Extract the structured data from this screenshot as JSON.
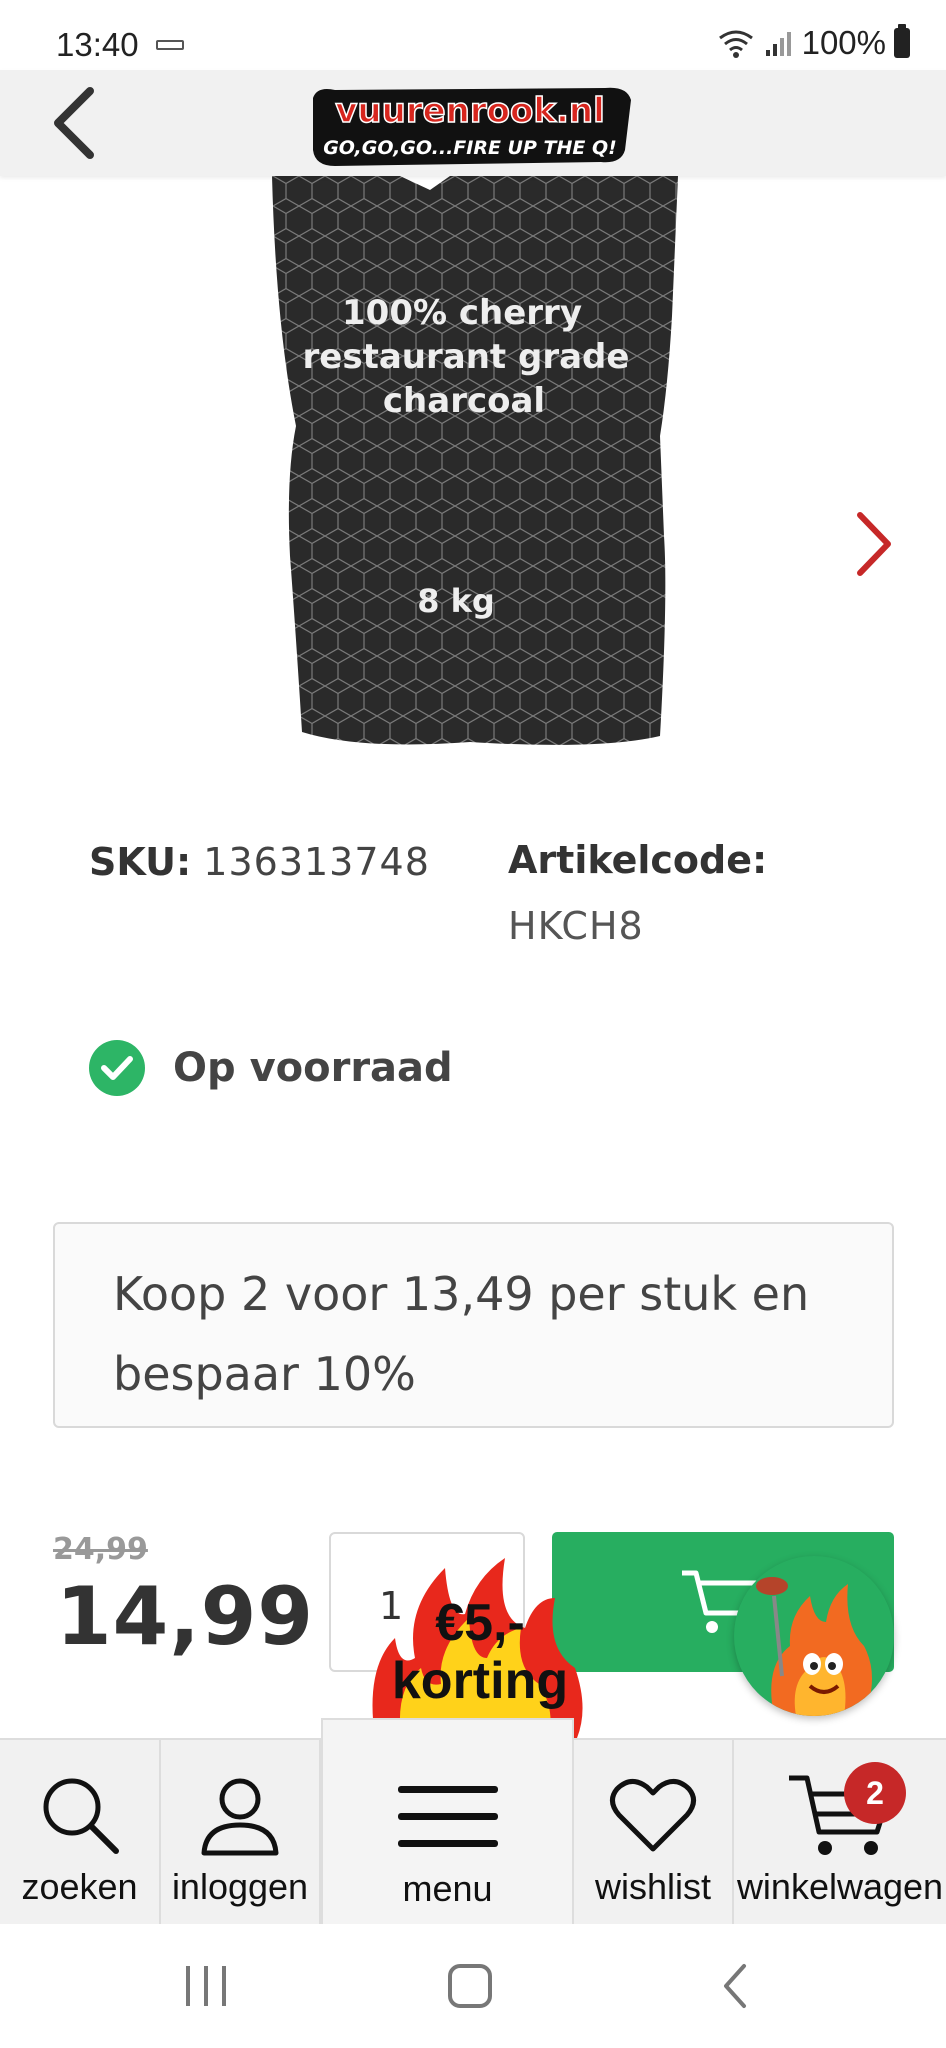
{
  "status_bar": {
    "time": "13:40",
    "battery": "100%"
  },
  "header": {
    "logo_text": "vuurenrook.nl",
    "logo_tagline": "GO,GO,GO...FIRE UP THE Q!"
  },
  "product": {
    "bag_line1": "100% cherry",
    "bag_line2": "restaurant grade",
    "bag_line3": "charcoal",
    "bag_weight": "8 kg",
    "sku_label": "SKU:",
    "sku_value": "136313748",
    "artikel_label": "Artikelcode:",
    "artikel_value": "HKCH8",
    "stock_status": "Op voorraad"
  },
  "offer": {
    "line1": "Koop 2 voor 13,49 per stuk en",
    "line2": "bespaar 10%"
  },
  "price": {
    "old": "24,99",
    "new": "14,99",
    "quantity": "1"
  },
  "promo": {
    "line1": "€5,-",
    "line2": "korting"
  },
  "bottom_nav": [
    {
      "label": "zoeken",
      "icon": "search-icon"
    },
    {
      "label": "inloggen",
      "icon": "user-icon"
    },
    {
      "label": "menu",
      "icon": "menu-icon"
    },
    {
      "label": "wishlist",
      "icon": "heart-icon"
    },
    {
      "label": "winkelwagen",
      "icon": "cart-icon"
    }
  ],
  "cart_count": "2",
  "colors": {
    "green": "#27ae60",
    "red": "#c62828",
    "header_bg": "#f1f1f1"
  }
}
